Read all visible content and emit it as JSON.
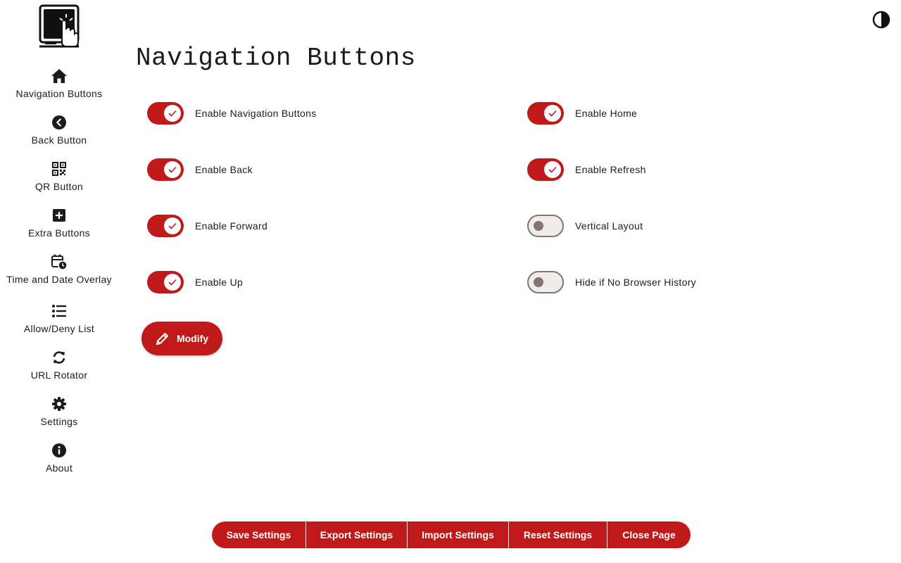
{
  "page": {
    "title": "Navigation Buttons"
  },
  "sidebar": {
    "items": [
      {
        "label": "Navigation Buttons",
        "icon": "home-icon"
      },
      {
        "label": "Back Button",
        "icon": "chevron-left-circle-icon"
      },
      {
        "label": "QR Button",
        "icon": "qr-code-icon"
      },
      {
        "label": "Extra Buttons",
        "icon": "add-box-icon"
      },
      {
        "label": "Time and Date Overlay",
        "icon": "calendar-clock-icon"
      },
      {
        "label": "Allow/Deny List",
        "icon": "list-icon"
      },
      {
        "label": "URL Rotator",
        "icon": "refresh-icon"
      },
      {
        "label": "Settings",
        "icon": "gear-icon"
      },
      {
        "label": "About",
        "icon": "info-icon"
      }
    ]
  },
  "toggles": {
    "left": [
      {
        "label": "Enable Navigation Buttons",
        "on": true
      },
      {
        "label": "Enable Back",
        "on": true
      },
      {
        "label": "Enable Forward",
        "on": true
      },
      {
        "label": "Enable Up",
        "on": true
      }
    ],
    "right": [
      {
        "label": "Enable Home",
        "on": true
      },
      {
        "label": "Enable Refresh",
        "on": true
      },
      {
        "label": "Vertical Layout",
        "on": false
      },
      {
        "label": "Hide if No Browser History",
        "on": false
      }
    ]
  },
  "modify_button": {
    "label": "Modify"
  },
  "bottom_bar": {
    "buttons": [
      {
        "label": "Save Settings"
      },
      {
        "label": "Export Settings"
      },
      {
        "label": "Import Settings"
      },
      {
        "label": "Reset Settings"
      },
      {
        "label": "Close Page"
      }
    ]
  },
  "colors": {
    "accent": "#c0191a",
    "text": "#1d1b1b",
    "switch_off_border": "#857371",
    "switch_off_bg": "#f1ecec"
  }
}
